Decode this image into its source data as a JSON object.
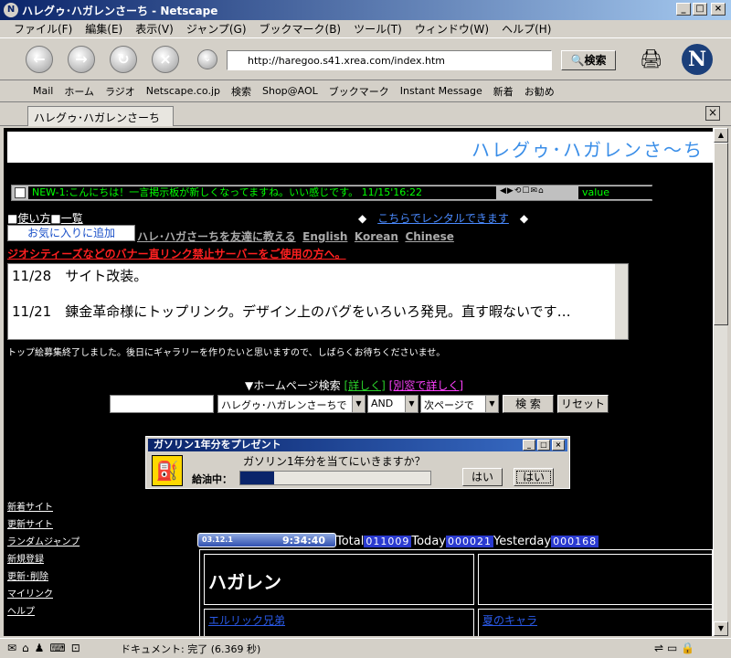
{
  "window": {
    "title": "ハレグゥ･ハガレンさーち - Netscape"
  },
  "menu": [
    "ファイル(F)",
    "編集(E)",
    "表示(V)",
    "ジャンプ(G)",
    "ブックマーク(B)",
    "ツール(T)",
    "ウィンドウ(W)",
    "ヘルプ(H)"
  ],
  "nav": {
    "url": "http://haregoo.s41.xrea.com/index.htm",
    "search_label": "検索"
  },
  "bookmarks": [
    "Mail",
    "ホーム",
    "ラジオ",
    "Netscape.co.jp",
    "検索",
    "Shop@AOL",
    "ブックマーク",
    "Instant Message",
    "新着",
    "お勧め"
  ],
  "tab": {
    "label": "ハレグゥ･ハガレンさーち"
  },
  "page": {
    "banner": "ハレグゥ･ハガレンさ〜ち",
    "ticker": "NEW-1:こんにちは！一言掲示板が新しくなってますね。いい感じです。 11/15'16:22",
    "ticker_value": "value",
    "howto": "使い方",
    "list": "一覧",
    "rental": "こちらでレンタルできます",
    "favorite": "お気に入りに追加",
    "tell_friend": "ハレ･ハガさーちを友達に教える",
    "english": "English",
    "korean": "Korean",
    "chinese": "Chinese",
    "warning": "ジオシティーズなどのバナー直リンク禁止サーバーをご使用の方へ。",
    "news": [
      {
        "date": "11/28",
        "text": "サイト改装。"
      },
      {
        "date": "11/21",
        "text": "錬金革命様にトップリンク。デザイン上のバグをいろいろ発見。直す暇ないです…"
      }
    ],
    "note": "トップ絵募集終了しました。後日にギャラリーを作りたいと思いますので、しばらくお待ちくださいませ。",
    "hp_search": "▼ホームページ検索",
    "detail": "[詳しく]",
    "detail_new": "[別窓で詳しく]",
    "select_site": "ハレグゥ･ハガレンさーちで",
    "select_op": "AND",
    "select_page": "次ページで",
    "search_btn": "検 索",
    "reset_btn": "リセット",
    "dialog_title": "ガソリン1年分をプレゼント",
    "dialog_question": "ガソリン1年分を当てにいきますか？",
    "dialog_refuel": "給油中：",
    "dialog_progress_pct": 18,
    "yes1": "はい",
    "yes2": "はい",
    "side_links": [
      "新着サイト",
      "更新サイト",
      "ランダムジャンプ",
      "新規登録",
      "更新･削除",
      "マイリンク",
      "ヘルプ"
    ],
    "clock_date": "03.12.1",
    "clock_time": "9:34:40",
    "total_label": "Total",
    "total": "011009",
    "today_label": "Today",
    "today": "000021",
    "yesterday_label": "Yesterday",
    "yesterday": "000168",
    "cell_title": "ハガレン",
    "cell_left": "エルリック兄弟",
    "cell_right": "夏のキャラ"
  },
  "status": {
    "text": "ドキュメント: 完了 (6.369 秒)"
  }
}
